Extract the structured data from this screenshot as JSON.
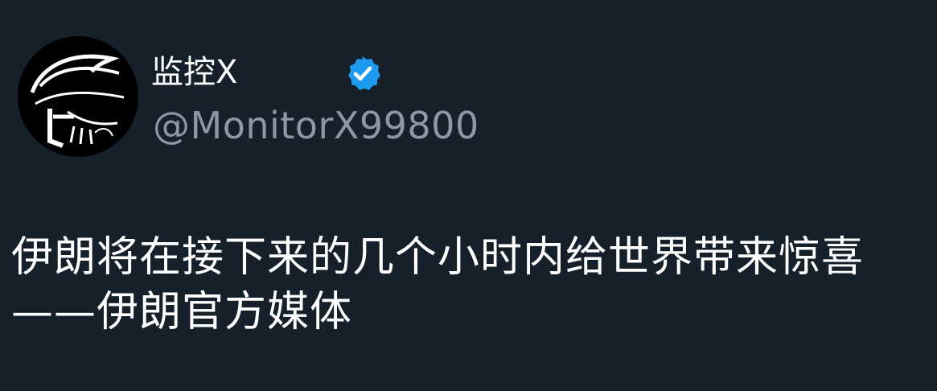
{
  "post": {
    "display_name": "监控X",
    "handle": "@MonitorX99800",
    "text": "伊朗将在接下来的几个小时内给世界带来惊喜——伊朗官方媒体"
  },
  "icons": {
    "avatar": "masked-figure-avatar",
    "badge": "verified-badge-icon"
  },
  "colors": {
    "background": "#16202b",
    "primary_text": "#ffffff",
    "secondary_text": "#8b98a5",
    "verified_blue": "#1d9bf0"
  }
}
